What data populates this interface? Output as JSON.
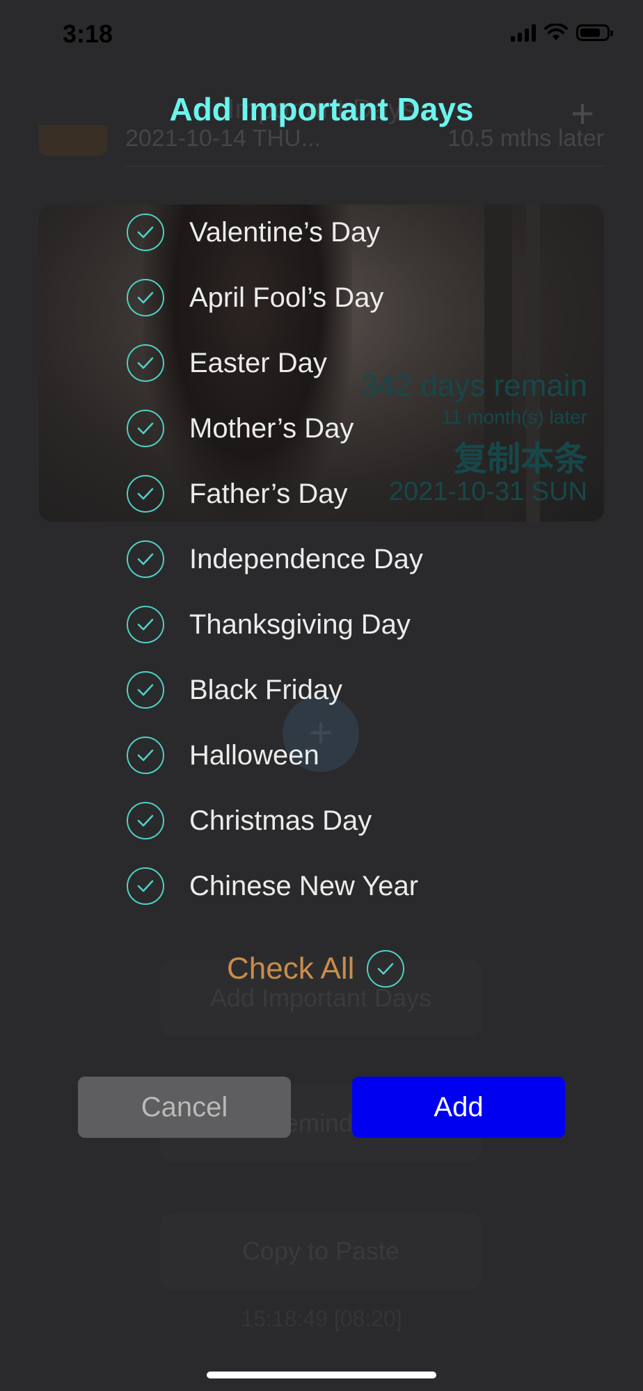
{
  "status_bar": {
    "time": "3:18"
  },
  "background_screen": {
    "header_title": "Important Days",
    "row_date": "2021-10-14",
    "row_name": "THU...",
    "row_later": "10.5 mths later",
    "card": {
      "remain": "342 days remain",
      "later": "11 month(s) later",
      "copy": "复制本条",
      "date": "2021-10-31 SUN"
    },
    "fab_icon": "plus-icon",
    "buttons": [
      "Add Important Days",
      "Reminder",
      "Copy to Paste"
    ],
    "timestamp": "15:18:49 [08:20]"
  },
  "dialog": {
    "title": "Add Important Days",
    "items": [
      {
        "label": "Valentine’s Day",
        "checked": true
      },
      {
        "label": "April Fool’s Day",
        "checked": true
      },
      {
        "label": "Easter Day",
        "checked": true
      },
      {
        "label": "Mother’s Day",
        "checked": true
      },
      {
        "label": "Father’s Day",
        "checked": true
      },
      {
        "label": "Independence Day",
        "checked": true
      },
      {
        "label": "Thanksgiving Day",
        "checked": true
      },
      {
        "label": "Black Friday",
        "checked": true
      },
      {
        "label": "Halloween",
        "checked": true
      },
      {
        "label": "Christmas Day",
        "checked": true
      },
      {
        "label": "Chinese New Year",
        "checked": true
      }
    ],
    "check_all_label": "Check All",
    "cancel_label": "Cancel",
    "add_label": "Add"
  },
  "colors": {
    "title": "#6cf4ee",
    "check": "#4fd1c5",
    "check_all": "#c98e4a",
    "add_button": "#0000f0",
    "cancel_button": "#5e5e60"
  }
}
